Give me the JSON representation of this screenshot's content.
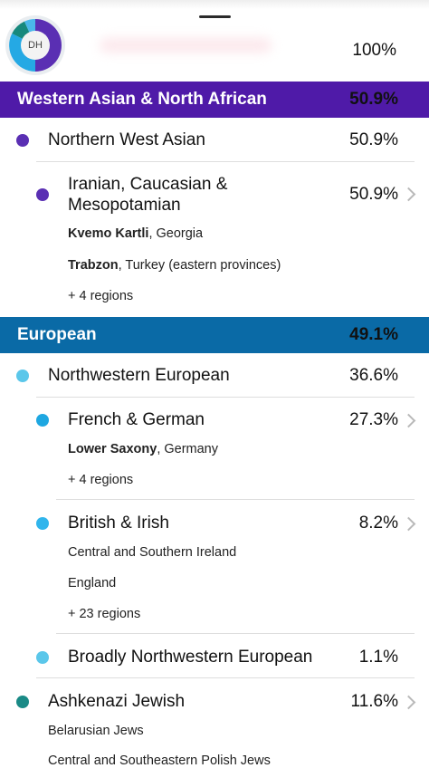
{
  "header": {
    "avatar_initials": "DH",
    "total_percent": "100%"
  },
  "colors": {
    "wana_band": "#4f1aa8",
    "european_band": "#0a6aa6",
    "purple_dot": "#5a2fb3",
    "light_blue_dot": "#5bc7ea",
    "blue_dot": "#1ea7e1",
    "teal_dot": "#1a8a86"
  },
  "groups": {
    "wana": {
      "label": "Western Asian & North African",
      "percent": "50.9%",
      "nw_asian": {
        "label": "Northern West Asian",
        "percent": "50.9%"
      },
      "iranian": {
        "label_line1": "Iranian, Caucasian &",
        "label_line2": "Mesopotamian",
        "percent": "50.9%",
        "region1_bold": "Kvemo Kartli",
        "region1_rest": ", Georgia",
        "region2_bold": "Trabzon",
        "region2_rest": ", Turkey (eastern provinces)",
        "more": "+ 4 regions"
      }
    },
    "european": {
      "label": "European",
      "percent": "49.1%",
      "nw_european": {
        "label": "Northwestern European",
        "percent": "36.6%"
      },
      "french_german": {
        "label": "French & German",
        "percent": "27.3%",
        "region1_bold": "Lower Saxony",
        "region1_rest": ", Germany",
        "more": "+ 4 regions"
      },
      "british_irish": {
        "label": "British & Irish",
        "percent": "8.2%",
        "region1": "Central and Southern Ireland",
        "region2": "England",
        "more": "+ 23 regions"
      },
      "broadly_nw": {
        "label": "Broadly Northwestern European",
        "percent": "1.1%"
      },
      "ashkenazi": {
        "label": "Ashkenazi Jewish",
        "percent": "11.6%",
        "region1": "Belarusian Jews",
        "region2": "Central and Southeastern Polish Jews"
      }
    }
  }
}
